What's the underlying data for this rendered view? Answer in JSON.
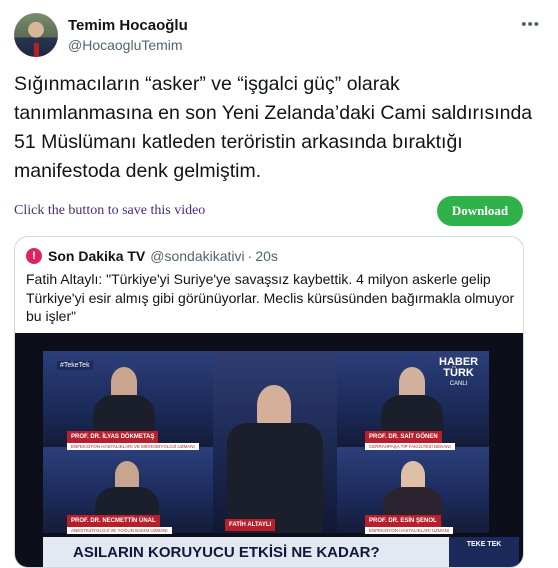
{
  "author": {
    "name": "Temim Hocaoğlu",
    "handle": "@HocaogluTemim"
  },
  "tweet": {
    "text": "Sığınmacıların “asker” ve “işgalci güç” olarak tanımlanmasına en son Yeni Zelanda’daki Cami saldırısında 51 Müslümanı katleden teröristin arkasında bıraktığı manifestoda denk gelmiştim."
  },
  "save_bar": {
    "label": "Click the button to save this video",
    "download_label": "Download"
  },
  "quote": {
    "logo_letter": "!",
    "name": "Son Dakika TV",
    "handle": "@sondakikativi",
    "separator": "·",
    "time": "20s",
    "text": "Fatih Altaylı: \"Türkiye'yi Suriye'ye savaşsız kaybettik. 4 milyon askerle gelip Türkiye'yi esir almış gibi görünüyorlar. Meclis kürsüsünden bağırmakla olmuyor bu işler\""
  },
  "video": {
    "hashtag": "#TekeTek",
    "channel_line1": "HABER",
    "channel_line2": "TÜRK",
    "channel_line3": "CANLI",
    "guests": [
      {
        "name": "PROF. DR. İLYAS DÖKMETAŞ",
        "title": "ENFEKSİYON HASTALIKLARI VE MİKROBİYOLOJİ UZMANI"
      },
      {
        "name": "FATİH ALTAYLI",
        "title": ""
      },
      {
        "name": "PROF. DR. SAİT GÖNEN",
        "title": "CERRAHPAŞA TIP FAKÜLTESİ DEKANI"
      },
      {
        "name": "PROF. DR. NECMETTİN ÜNAL",
        "title": "ANESTEZİYOLOJİ VE YOĞUN BAKIM UZMANI"
      },
      {
        "name": "PROF. DR. ESİN ŞENOL",
        "title": "ENFEKSİYON HASTALIKLARI UZMANI"
      }
    ],
    "bottom_text": "ASILARIN KORUYUCU ETKİSİ NE KADAR?",
    "bottom_brand": "TEKE TEK"
  },
  "colors": {
    "download": "#2fb24a",
    "caption": "#b61f2b",
    "quote_logo": "#e0245e"
  },
  "icons": {
    "more": "more-horizontal-icon"
  }
}
